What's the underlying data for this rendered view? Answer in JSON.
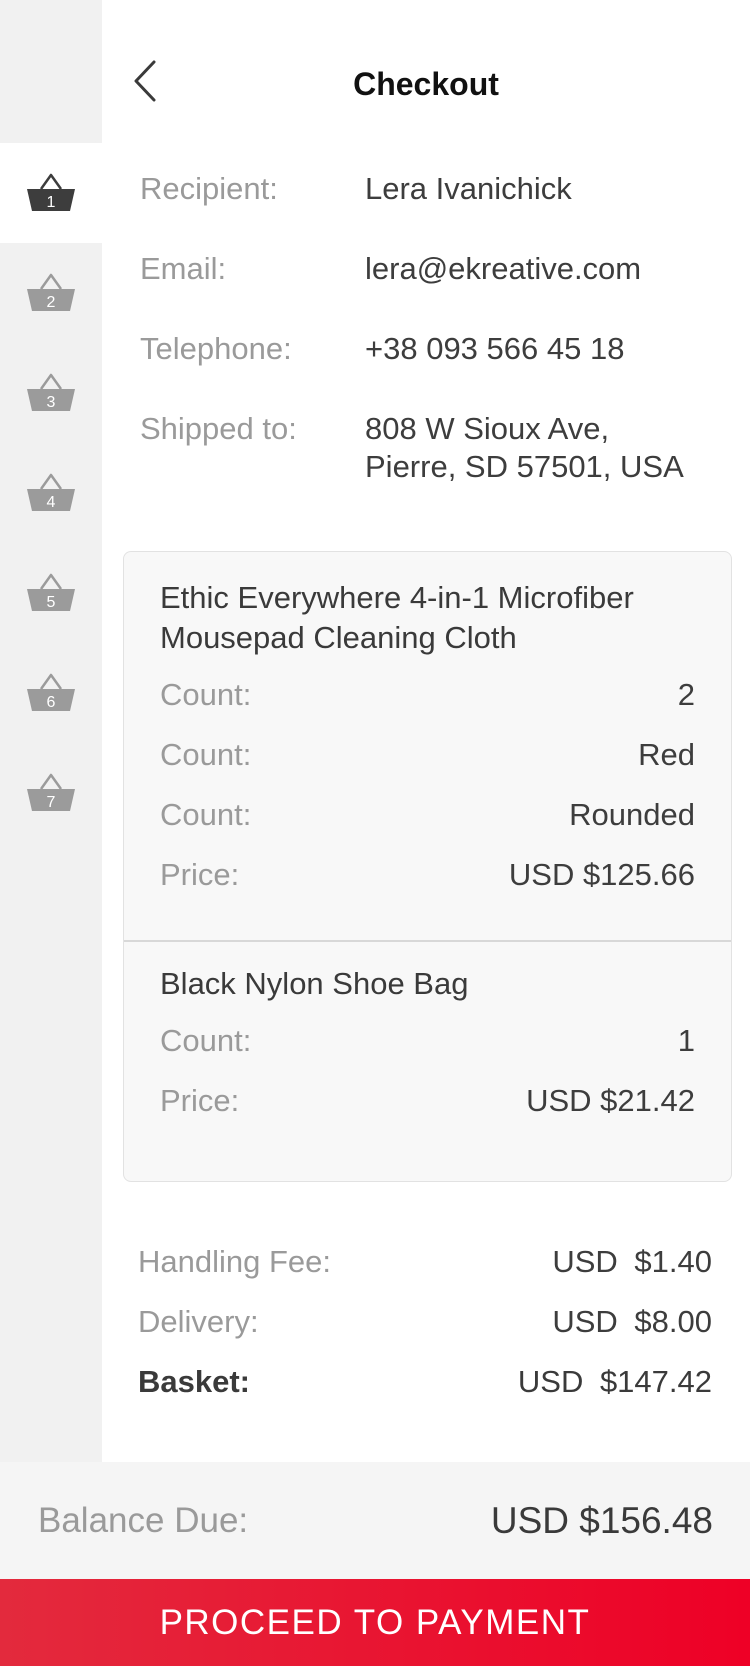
{
  "header": {
    "title": "Checkout"
  },
  "sidebar": {
    "baskets": [
      {
        "number": "1",
        "active": true
      },
      {
        "number": "2",
        "active": false
      },
      {
        "number": "3",
        "active": false
      },
      {
        "number": "4",
        "active": false
      },
      {
        "number": "5",
        "active": false
      },
      {
        "number": "6",
        "active": false
      },
      {
        "number": "7",
        "active": false
      }
    ]
  },
  "recipient_info": {
    "recipient": {
      "label": "Recipient:",
      "value": "Lera Ivanichick"
    },
    "email": {
      "label": "Email:",
      "value": "lera@ekreative.com"
    },
    "telephone": {
      "label": "Telephone:",
      "value": "+38 093 566 45 18"
    },
    "shipped_to": {
      "label": "Shipped to:",
      "line1": "808 W Sioux Ave,",
      "line2": "Pierre, SD 57501, USA"
    }
  },
  "items": [
    {
      "name_line1": "Ethic Everywhere 4-in-1 Microfiber",
      "name_line2": "Mousepad Cleaning Cloth",
      "rows": [
        {
          "label": "Count:",
          "value": "2"
        },
        {
          "label": "Count:",
          "value": "Red"
        },
        {
          "label": "Count:",
          "value": "Rounded"
        },
        {
          "label": "Price:",
          "value": "USD $125.66"
        }
      ]
    },
    {
      "name": "Black Nylon Shoe Bag",
      "rows": [
        {
          "label": "Count:",
          "value": "1"
        },
        {
          "label": "Price:",
          "value": "USD $21.42"
        }
      ]
    }
  ],
  "totals": {
    "handling_fee": {
      "label": "Handling Fee:",
      "value": "USD $1.40"
    },
    "delivery": {
      "label": "Delivery:",
      "value": "USD $8.00"
    },
    "basket": {
      "label": "Basket:",
      "value": "USD $147.42"
    }
  },
  "balance": {
    "label": "Balance Due:",
    "value": "USD $156.48"
  },
  "payment_button": {
    "label": "PROCEED TO PAYMENT"
  },
  "colors": {
    "accent": "#ee0026",
    "sidebar_bg": "#f1f1f1",
    "active_basket": "#3d3d3d",
    "inactive_basket": "#9b9b9b"
  }
}
